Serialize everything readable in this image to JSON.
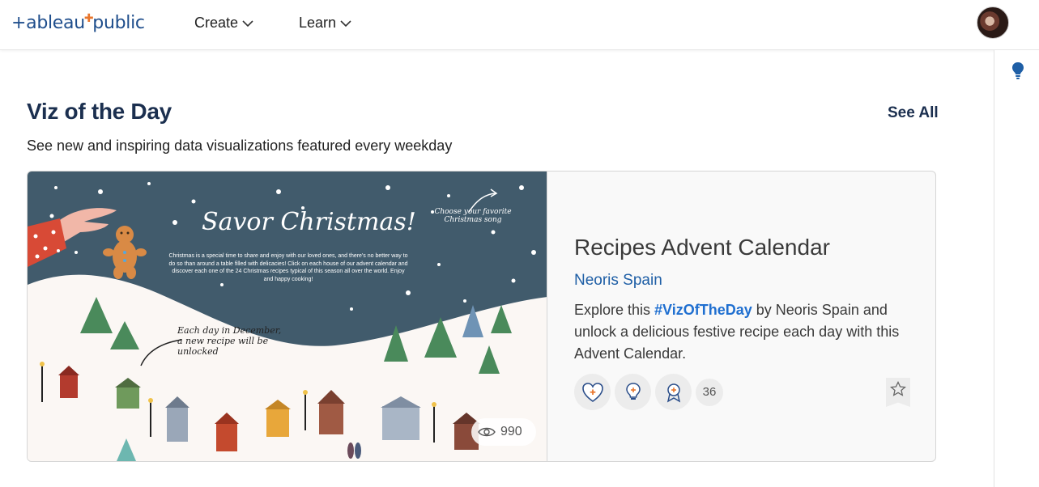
{
  "header": {
    "logo_text_a": "+ableau",
    "logo_text_b": "public",
    "nav": [
      {
        "label": "Create"
      },
      {
        "label": "Learn"
      }
    ]
  },
  "section": {
    "title": "Viz of the Day",
    "see_all": "See All",
    "subtitle": "See new and inspiring data visualizations featured every weekday"
  },
  "card": {
    "thumbnail": {
      "headline": "Savor Christmas!",
      "intro": "Christmas is a special time to share and enjoy with our loved ones, and there's no better way to do so than around a table filled with delicacies! Click on each house of our advent calendar and discover each one of the 24 Christmas recipes typical of this season all over the world. Enjoy and happy cooking!",
      "note_song": "Choose your favorite Christmas song",
      "note_day": "Each day in December, a new recipe will be unlocked",
      "views": "990"
    },
    "title": "Recipes Advent Calendar",
    "author": "Neoris Spain",
    "desc_prefix": "Explore this ",
    "desc_tag": "#VizOfTheDay",
    "desc_suffix": " by Neoris Spain and unlock a delicious festive recipe each day with this Advent Calendar.",
    "badge_count": "36"
  },
  "colors": {
    "brand": "#1f4e8c",
    "heading": "#1b2f4f",
    "link": "#1f5fa6",
    "sky": "#3f5a6b"
  }
}
